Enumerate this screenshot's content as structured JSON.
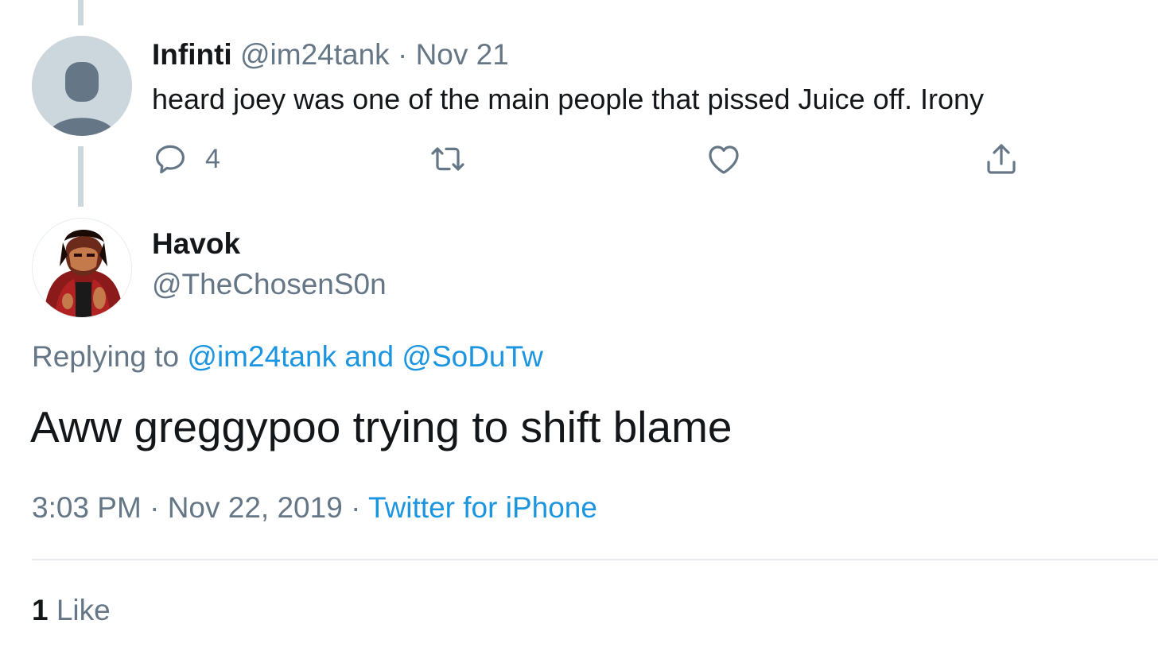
{
  "parent_tweet": {
    "display_name": "Infinti",
    "handle": "@im24tank",
    "separator": "·",
    "date": "Nov 21",
    "text": "heard joey was one of the main people that pissed Juice off.  Irony",
    "reply_count": "4",
    "icons": [
      "reply-icon",
      "retweet-icon",
      "like-icon",
      "share-icon"
    ]
  },
  "reply_tweet": {
    "display_name": "Havok",
    "handle": "@TheChosenS0n",
    "replying_prefix": "Replying to",
    "replying_handle_1": "@im24tank",
    "replying_and": "and",
    "replying_handle_2": "@SoDuTw",
    "text": "Aww greggypoo trying to shift blame",
    "time": "3:03 PM",
    "separator": "·",
    "date": "Nov 22, 2019",
    "source": "Twitter for iPhone",
    "like_count": "1",
    "like_label": "Like"
  },
  "colors": {
    "text_primary": "#14171a",
    "text_secondary": "#657786",
    "link": "#1b95e0",
    "thread_line": "#ccd6dd",
    "divider": "#e6ecf0"
  }
}
